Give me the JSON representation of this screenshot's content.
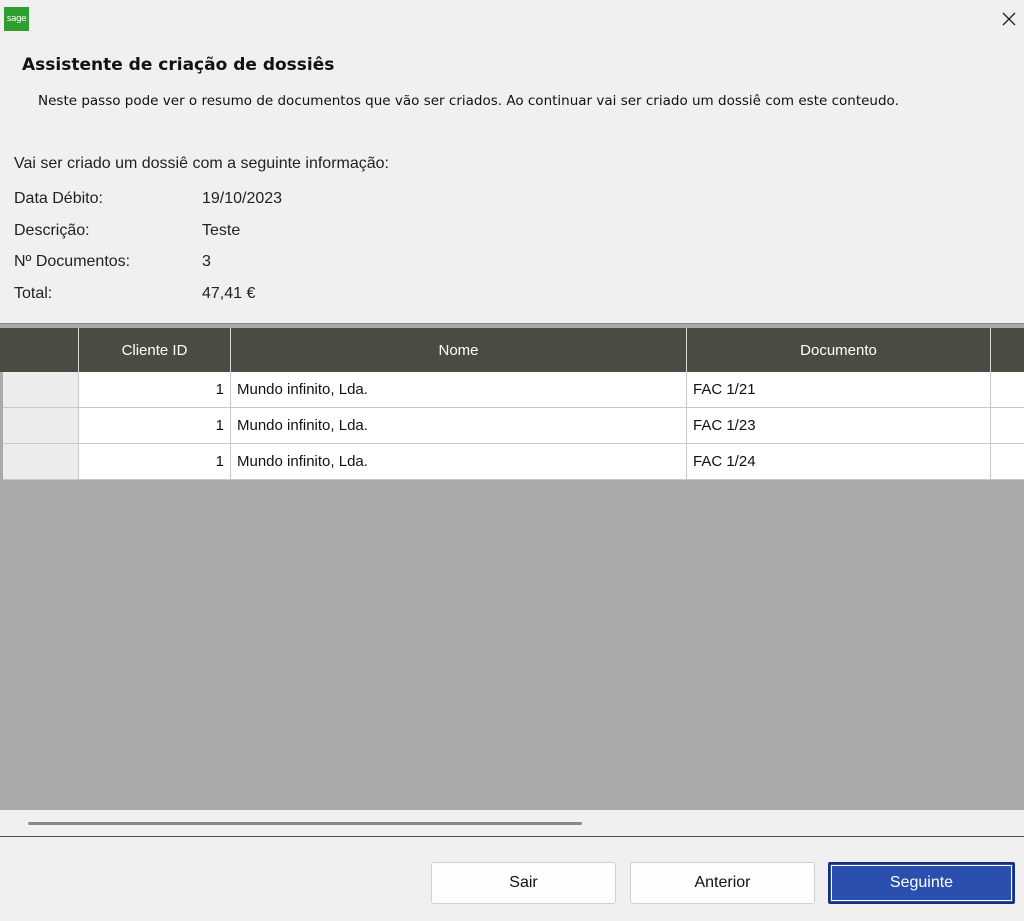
{
  "window": {
    "app_logo_text": "sage",
    "close_glyph": "✕"
  },
  "header": {
    "title": "Assistente de criação de dossiês",
    "description": "Neste passo pode ver o resumo de documentos que vão ser criados. Ao continuar vai ser criado um dossiê com este conteudo."
  },
  "summary": {
    "intro": "Vai ser criado um dossiê com a seguinte informação:",
    "fields": [
      {
        "label": "Data Débito:",
        "value": "19/10/2023"
      },
      {
        "label": "Descrição:",
        "value": "Teste"
      },
      {
        "label": "Nº Documentos:",
        "value": "3"
      },
      {
        "label": "Total:",
        "value": "47,41 €"
      }
    ]
  },
  "grid": {
    "columns": [
      "Cliente ID",
      "Nome",
      "Documento"
    ],
    "rows": [
      {
        "cliente_id": "1",
        "nome": "Mundo infinito, Lda.",
        "documento": "FAC 1/21"
      },
      {
        "cliente_id": "1",
        "nome": "Mundo infinito, Lda.",
        "documento": "FAC 1/23"
      },
      {
        "cliente_id": "1",
        "nome": "Mundo infinito, Lda.",
        "documento": "FAC 1/24"
      }
    ]
  },
  "footer": {
    "exit_label": "Sair",
    "previous_label": "Anterior",
    "next_label": "Seguinte"
  },
  "colors": {
    "grid_header": "#4b4b44",
    "grid_background": "#aaaaaa",
    "primary_button": "#2b4fae",
    "logo": "#2f9d2f"
  }
}
